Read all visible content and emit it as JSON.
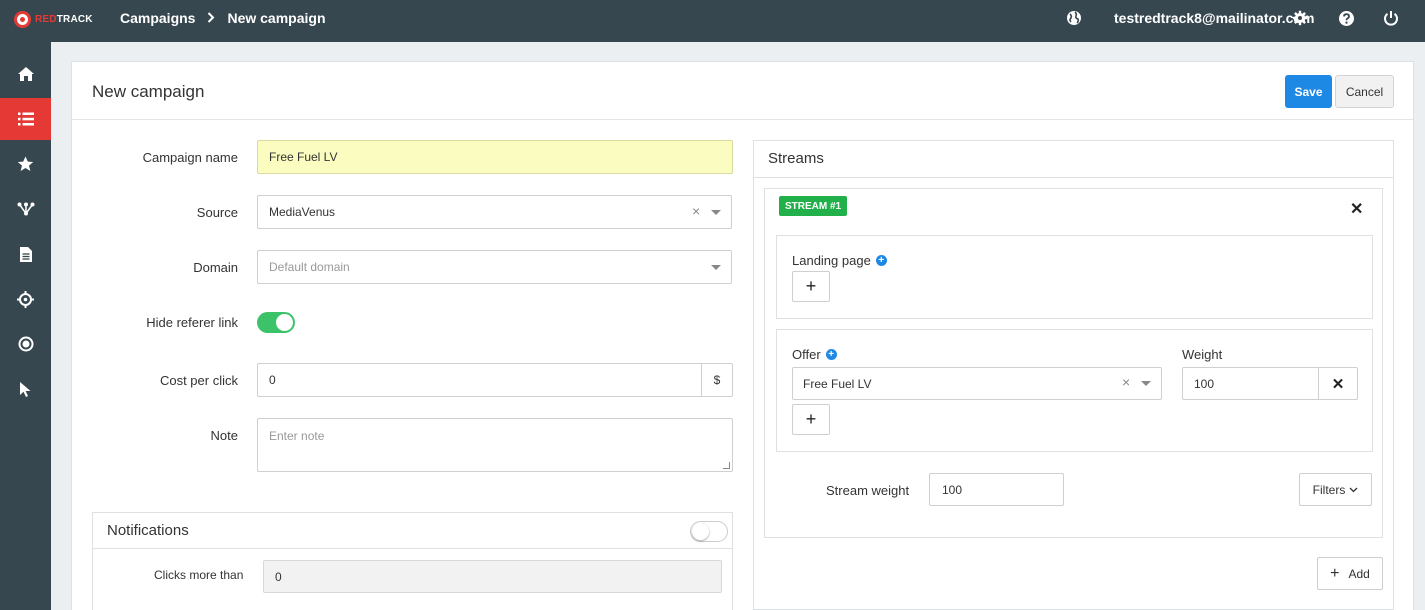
{
  "app": {
    "logo_red": "RED",
    "logo_white": "TRACK",
    "breadcrumb": [
      "Campaigns",
      "New campaign"
    ],
    "user_email": "testredtrack8@mailinator.com"
  },
  "icons": {
    "globe": "globe-icon",
    "gear": "gear-icon",
    "help": "help-icon",
    "power": "power-icon"
  },
  "sidebar": {
    "items": [
      {
        "icon": "home-icon",
        "active": false
      },
      {
        "icon": "list-icon",
        "active": true
      },
      {
        "icon": "star-icon",
        "active": false
      },
      {
        "icon": "funnel-icon",
        "active": false
      },
      {
        "icon": "document-icon",
        "active": false
      },
      {
        "icon": "crosshair-icon",
        "active": false
      },
      {
        "icon": "target-icon",
        "active": false
      },
      {
        "icon": "cursor-icon",
        "active": false
      }
    ]
  },
  "page": {
    "title": "New campaign",
    "save_label": "Save",
    "cancel_label": "Cancel"
  },
  "form": {
    "campaign_name_label": "Campaign name",
    "campaign_name_value": "Free Fuel LV",
    "source_label": "Source",
    "source_value": "MediaVenus",
    "domain_label": "Domain",
    "domain_placeholder": "Default domain",
    "hide_referer_label": "Hide referer link",
    "hide_referer_on": true,
    "cpc_label": "Cost per click",
    "cpc_value": "0",
    "cpc_currency": "$",
    "note_label": "Note",
    "note_placeholder": "Enter note"
  },
  "notifications": {
    "title": "Notifications",
    "enabled": false,
    "clicks_label": "Clicks more than",
    "clicks_value": "0"
  },
  "streams": {
    "title": "Streams",
    "stream": {
      "badge": "STREAM #1",
      "landing_label": "Landing page",
      "offer_label": "Offer",
      "offer_value": "Free Fuel LV",
      "weight_label": "Weight",
      "weight_value": "100",
      "stream_weight_label": "Stream weight",
      "stream_weight_value": "100",
      "filters_label": "Filters"
    },
    "add_label": "Add"
  },
  "colors": {
    "topbar": "#37474f",
    "accent_red": "#e53935",
    "primary_blue": "#1e88e5",
    "toggle_green": "#3cc36a",
    "badge_green": "#22b04b",
    "highlight_yellow": "#fafcc0"
  }
}
